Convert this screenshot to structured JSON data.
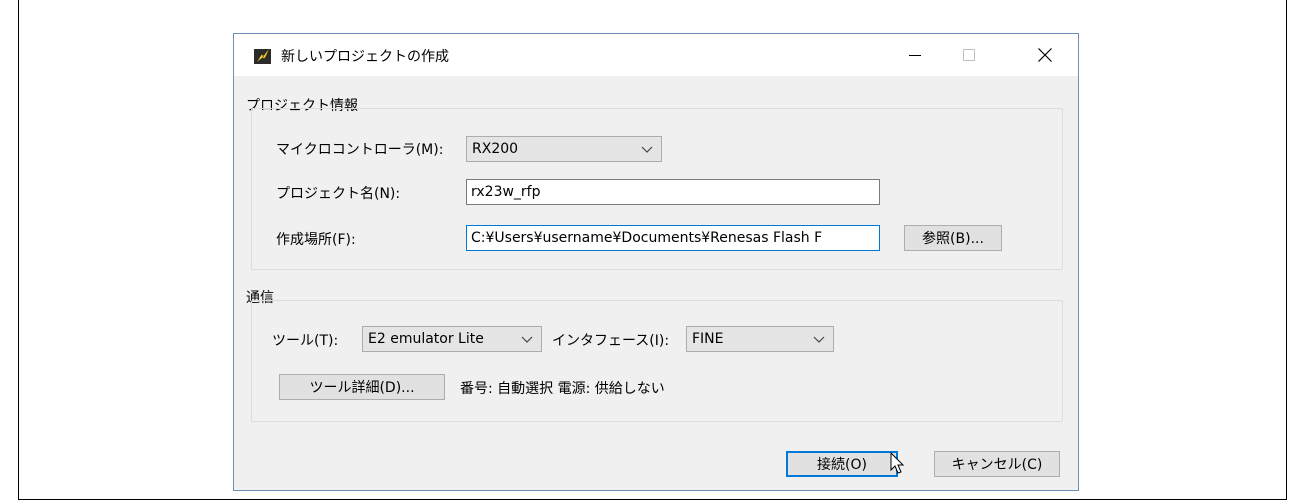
{
  "window": {
    "title": "新しいプロジェクトの作成"
  },
  "project_info": {
    "group_label": "プロジェクト情報",
    "microcontroller_label": "マイクロコントローラ(M):",
    "microcontroller_value": "RX200",
    "project_name_label": "プロジェクト名(N):",
    "project_name_value": "rx23w_rfp",
    "location_label": "作成場所(F):",
    "location_value": "C:¥Users¥username¥Documents¥Renesas Flash F",
    "browse_button": "参照(B)..."
  },
  "communication": {
    "group_label": "通信",
    "tool_label": "ツール(T):",
    "tool_value": "E2 emulator Lite",
    "interface_label": "インタフェース(I):",
    "interface_value": "FINE",
    "tool_details_button": "ツール詳細(D)...",
    "status_text": "番号: 自動選択  電源: 供給しない"
  },
  "footer": {
    "connect_button": "接続(O)",
    "cancel_button": "キャンセル(C)"
  },
  "icons": {
    "app": "lightning-app-icon",
    "minimize": "minimize-icon",
    "maximize": "maximize-icon",
    "close": "close-icon",
    "dropdown": "chevron-down-icon",
    "cursor": "mouse-cursor-icon"
  },
  "colors": {
    "accent": "#0078d7",
    "dialog_bg": "#f0f0f0",
    "titlebar_bg": "#ffffff"
  }
}
